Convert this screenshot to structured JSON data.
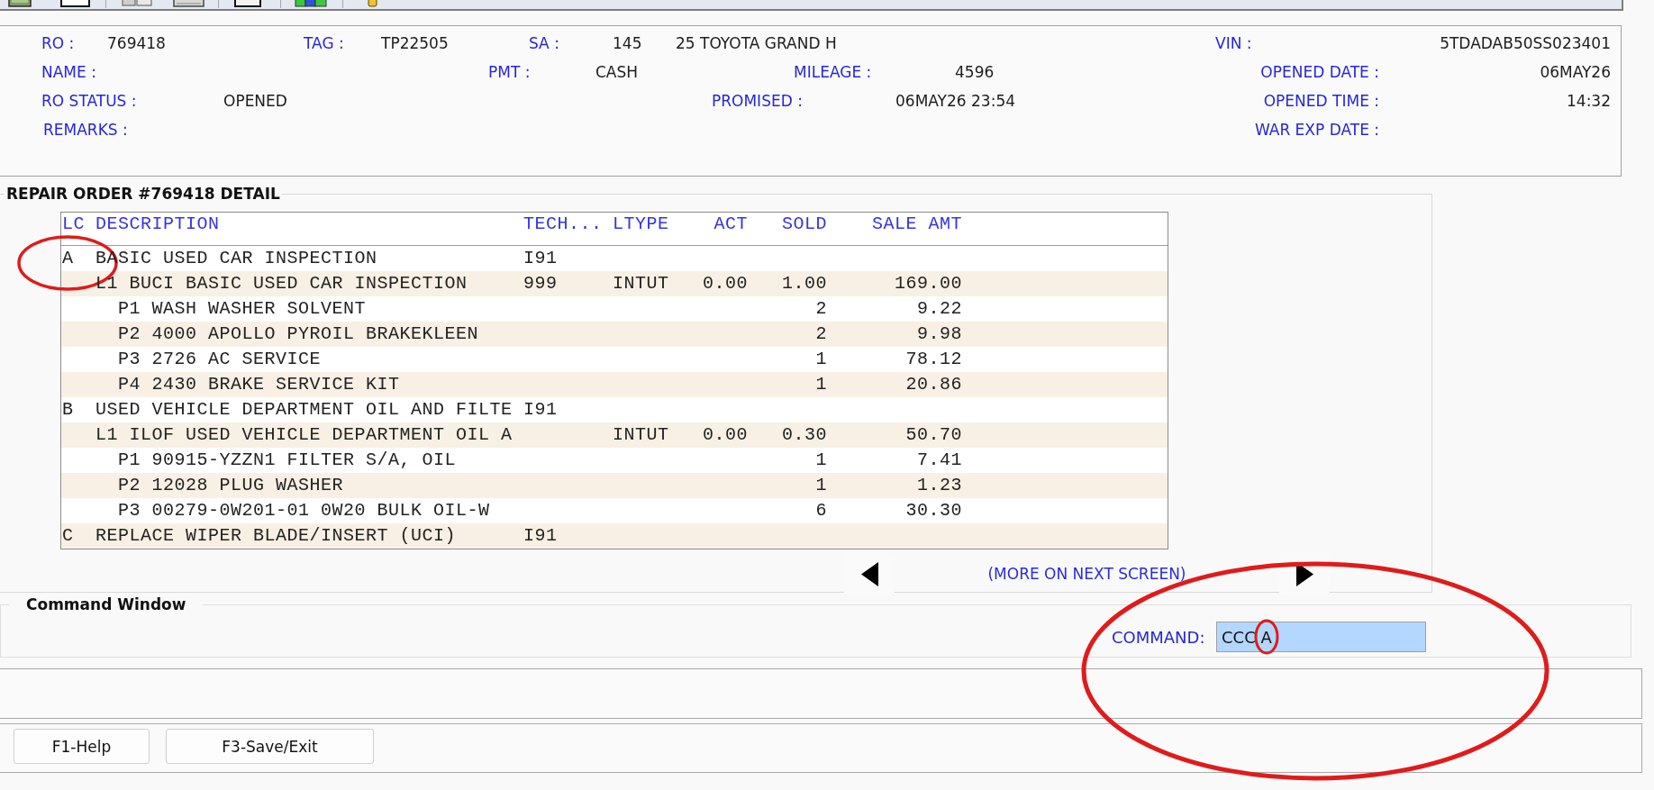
{
  "header": {
    "rows": [
      {
        "fields": [
          {
            "label": "RO :",
            "value": "769418"
          },
          {
            "label": "TAG :",
            "value": "TP22505"
          },
          {
            "label": "SA :",
            "value": "145"
          },
          {
            "value": "25 TOYOTA GRAND H"
          },
          {
            "label": "VIN :",
            "value": "5TDADAB50SS023401"
          }
        ]
      },
      {
        "fields": [
          {
            "label": "NAME :"
          },
          {
            "label": "PMT :",
            "value": "CASH"
          },
          {
            "label": "MILEAGE :",
            "value": "4596"
          },
          {
            "label": "OPENED DATE :",
            "value": "06MAY26"
          }
        ]
      },
      {
        "fields": [
          {
            "label": "RO STATUS :",
            "value": "OPENED"
          },
          {
            "label": "PROMISED :",
            "value": "06MAY26 23:54"
          },
          {
            "label": "OPENED TIME :",
            "value": "14:32"
          }
        ]
      },
      {
        "fields": [
          {
            "label": "REMARKS :"
          },
          {
            "label": "WAR EXP DATE :"
          }
        ]
      }
    ]
  },
  "repair_order": {
    "title": "REPAIR ORDER #769418 DETAIL",
    "columns": [
      "LC",
      "DESCRIPTION",
      "TECH...",
      "LTYPE",
      "ACT",
      "SOLD",
      "SALE AMT"
    ],
    "lines": [
      {
        "lc": "A",
        "description": "BASIC USED CAR INSPECTION",
        "tech": "I91",
        "children": [
          {
            "description": "L1 BUCI BASIC USED CAR INSPECTION",
            "tech": "999",
            "ltype": "INTUT",
            "act": "0.00",
            "sold": "1.00",
            "sale_amt": "169.00",
            "children": [
              {
                "description": "P1 WASH WASHER SOLVENT",
                "sold": "2",
                "sale_amt": "9.22"
              },
              {
                "description": "P2 4000 APOLLO PYROIL BRAKEKLEEN",
                "sold": "2",
                "sale_amt": "9.98"
              },
              {
                "description": "P3 2726 AC SERVICE",
                "sold": "1",
                "sale_amt": "78.12"
              },
              {
                "description": "P4 2430 BRAKE SERVICE KIT",
                "sold": "1",
                "sale_amt": "20.86"
              }
            ]
          }
        ]
      },
      {
        "lc": "B",
        "description": "USED VEHICLE DEPARTMENT OIL AND FILTE",
        "tech": "I91",
        "children": [
          {
            "description": "L1 ILOF USED VEHICLE DEPARTMENT OIL A",
            "ltype": "INTUT",
            "act": "0.00",
            "sold": "0.30",
            "sale_amt": "50.70",
            "children": [
              {
                "description": "P1 90915-YZZN1 FILTER S/A, OIL",
                "sold": "1",
                "sale_amt": "7.41"
              },
              {
                "description": "P2 12028 PLUG WASHER",
                "sold": "1",
                "sale_amt": "1.23"
              },
              {
                "description": "P3 00279-0W201-01 0W20 BULK OIL-W",
                "sold": "6",
                "sale_amt": "30.30"
              }
            ]
          }
        ]
      },
      {
        "lc": "C",
        "description": "REPLACE WIPER BLADE/INSERT (UCI)",
        "tech": "I91"
      }
    ],
    "more_notice": "(MORE ON NEXT SCREEN)"
  },
  "command_window": {
    "title": "Command Window",
    "label": "COMMAND:",
    "value": "CCC A"
  },
  "buttons": [
    "F1-Help",
    "F3-Save/Exit"
  ]
}
